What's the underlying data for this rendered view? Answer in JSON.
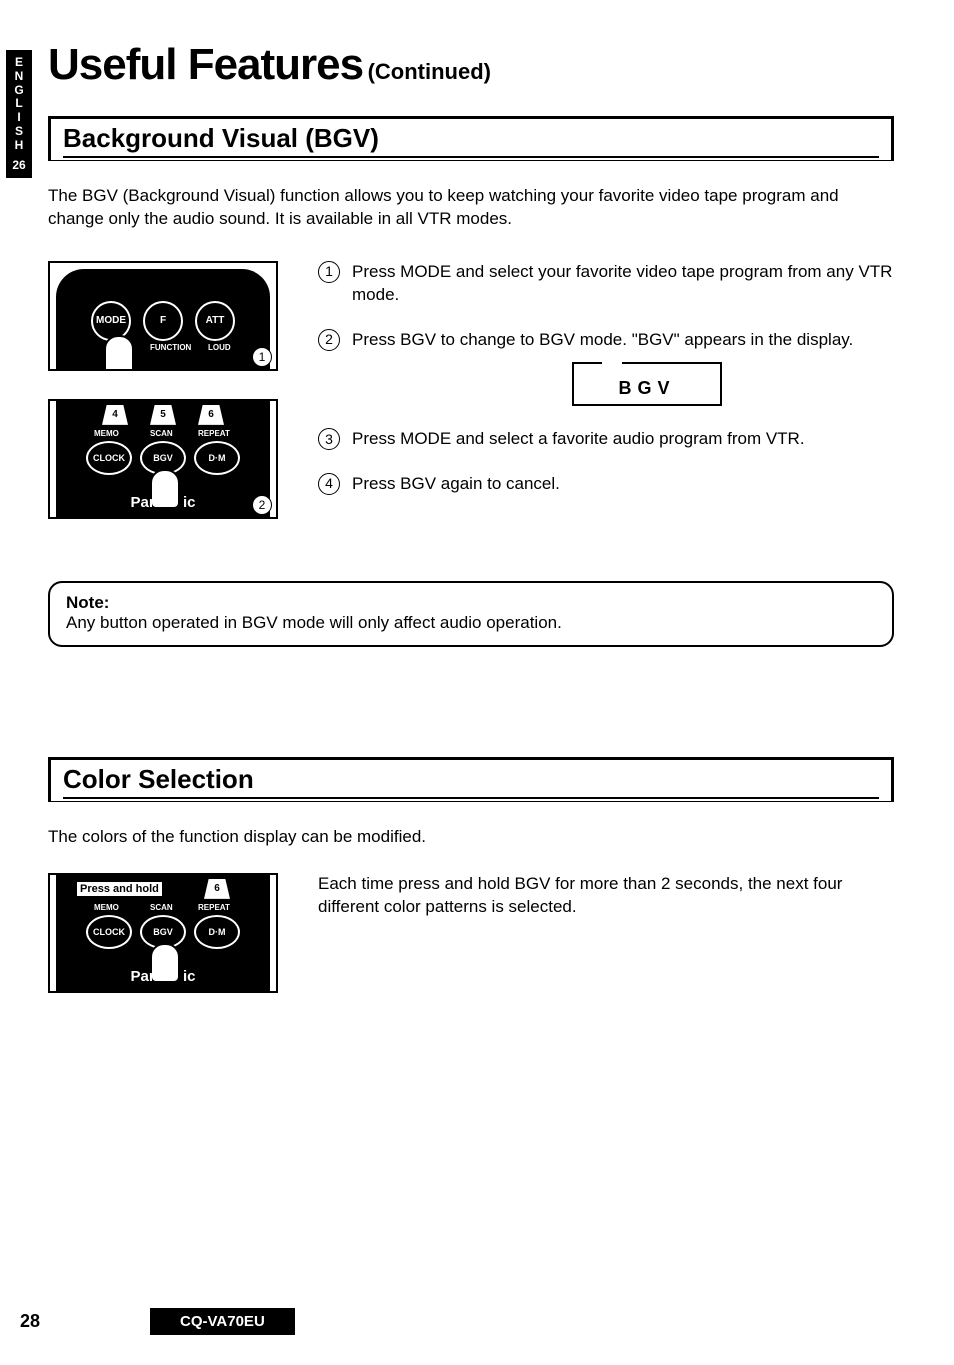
{
  "sidebar": {
    "lang": "ENGLISH",
    "page_tab": "26"
  },
  "title": {
    "main": "Useful Features",
    "suffix": "(Continued)"
  },
  "section1": {
    "heading": "Background Visual (BGV)",
    "intro": "The BGV (Background Visual) function allows you to keep watching your favorite video tape program and change only the audio sound. It is available in all VTR modes.",
    "fig1": {
      "buttons": {
        "b1": "MODE",
        "b2": "F",
        "b3": "ATT"
      },
      "labels": {
        "l1": "FUNCTION",
        "l2": "LOUD"
      },
      "marker": "1"
    },
    "fig2": {
      "presets": {
        "p1": "4",
        "p2": "5",
        "p3": "6"
      },
      "labels": {
        "l1": "MEMO",
        "l2": "SCAN",
        "l3": "REPEAT"
      },
      "buttons": {
        "b1": "CLOCK",
        "b2": "BGV",
        "b3": "D·M"
      },
      "brand_left": "Pana",
      "brand_right": "ic",
      "marker": "2"
    },
    "steps": {
      "s1": "Press MODE and select your favorite video tape program from any VTR mode.",
      "s2": "Press BGV to change to BGV mode. \"BGV\" appears in the display.",
      "s3": "Press MODE and select a favorite audio program from VTR.",
      "s4": "Press BGV again to cancel."
    },
    "display_text": "BGV",
    "note": {
      "label": "Note:",
      "text": "Any button operated in BGV mode will only affect audio operation."
    }
  },
  "section2": {
    "heading": "Color Selection",
    "intro": "The colors of the function display can be modified.",
    "fig": {
      "press_hold": "Press and hold",
      "preset6": "6",
      "labels": {
        "l1": "MEMO",
        "l2": "SCAN",
        "l3": "REPEAT"
      },
      "buttons": {
        "b1": "CLOCK",
        "b2": "BGV",
        "b3": "D·M"
      },
      "brand_left": "Pana",
      "brand_right": "ic"
    },
    "body": "Each time press and hold BGV for more than 2 seconds, the next four different color patterns is selected."
  },
  "footer": {
    "page": "28",
    "model": "CQ-VA70EU"
  }
}
